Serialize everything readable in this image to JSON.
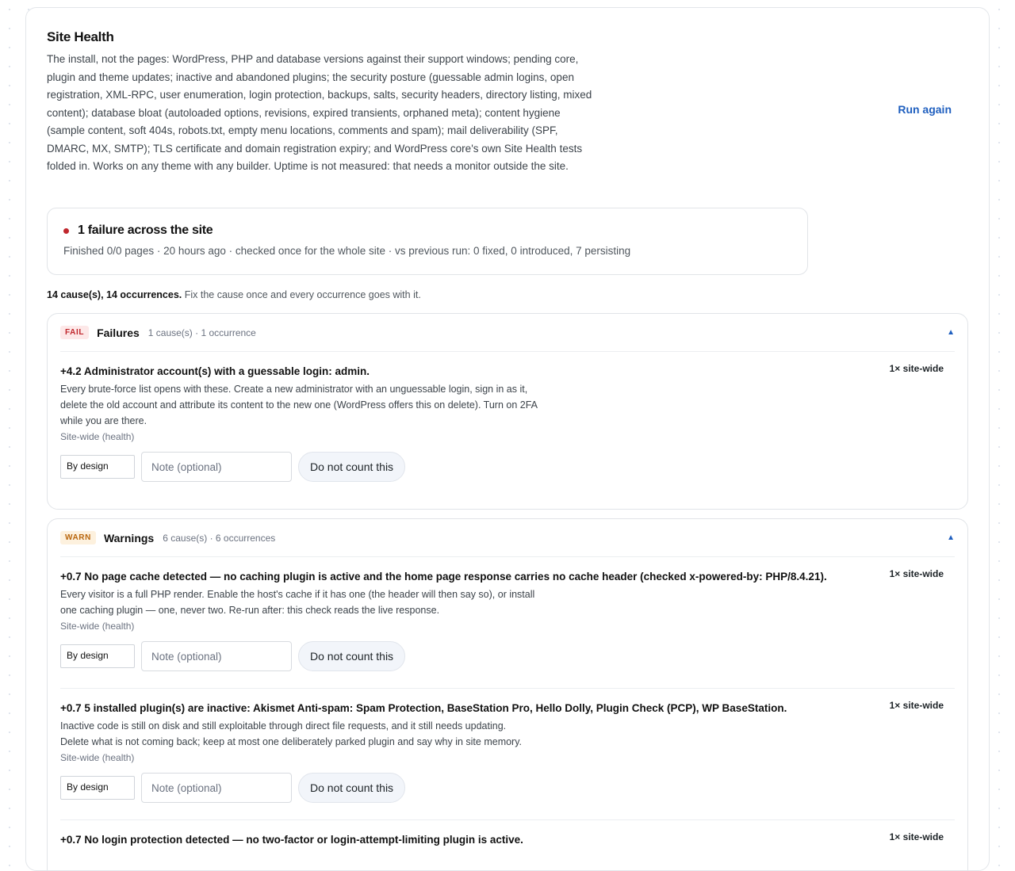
{
  "header": {
    "title": "Site Health",
    "description": "The install, not the pages: WordPress, PHP and database versions against their support windows; pending core, plugin and theme updates; inactive and abandoned plugins; the security posture (guessable admin logins, open registration, XML-RPC, user enumeration, login protection, backups, salts, security headers, directory listing, mixed content); database bloat (autoloaded options, revisions, expired transients, orphaned meta); content hygiene (sample content, soft 404s, robots.txt, empty menu locations, comments and spam); mail deliverability (SPF, DMARC, MX, SMTP); TLS certificate and domain registration expiry; and WordPress core's own Site Health tests folded in. Works on any theme with any builder. Uptime is not measured: that needs a monitor outside the site.",
    "run_again": "Run again"
  },
  "summary": {
    "title": "1 failure across the site",
    "subtitle": "Finished 0/0 pages · 20 hours ago · checked once for the whole site · vs previous run: 0 fixed, 0 introduced, 7 persisting",
    "status_color": "#c0272d"
  },
  "counts": {
    "bold": "14 cause(s), 14 occurrences.",
    "rest": "Fix the cause once and every occurrence goes with it."
  },
  "controls": {
    "select_value": "By design",
    "note_placeholder": "Note (optional)",
    "exclude_label": "Do not count this"
  },
  "groups": [
    {
      "badge": "FAIL",
      "name": "Failures",
      "meta": "1 cause(s) · 1 occurrence",
      "chevron": "▲",
      "items": [
        {
          "title": "+4.2 Administrator account(s) with a guessable login: admin.",
          "scope": "1× site-wide",
          "desc": "Every brute-force list opens with these. Create a new administrator with an unguessable login, sign in as it, delete the old account and attribute its content to the new one (WordPress offers this on delete). Turn on 2FA while you are there.",
          "site": "Site-wide (health)"
        }
      ]
    },
    {
      "badge": "WARN",
      "name": "Warnings",
      "meta": "6 cause(s) · 6 occurrences",
      "chevron": "▲",
      "items": [
        {
          "title": "+0.7 No page cache detected — no caching plugin is active and the home page response carries no cache header (checked x-powered-by: PHP/8.4.21).",
          "scope": "1× site-wide",
          "desc": "Every visitor is a full PHP render. Enable the host's cache if it has one (the header will then say so), or install one caching plugin — one, never two. Re-run after: this check reads the live response.",
          "site": "Site-wide (health)"
        },
        {
          "title": "+0.7 5 installed plugin(s) are inactive: Akismet Anti-spam: Spam Protection, BaseStation Pro, Hello Dolly, Plugin Check (PCP), WP BaseStation.",
          "scope": "1× site-wide",
          "desc": "Inactive code is still on disk and still exploitable through direct file requests, and it still needs updating. Delete what is not coming back; keep at most one deliberately parked plugin and say why in site memory.",
          "site": "Site-wide (health)"
        },
        {
          "title": "+0.7 No login protection detected — no two-factor or login-attempt-limiting plugin is active.",
          "scope": "1× site-wide"
        }
      ]
    }
  ]
}
